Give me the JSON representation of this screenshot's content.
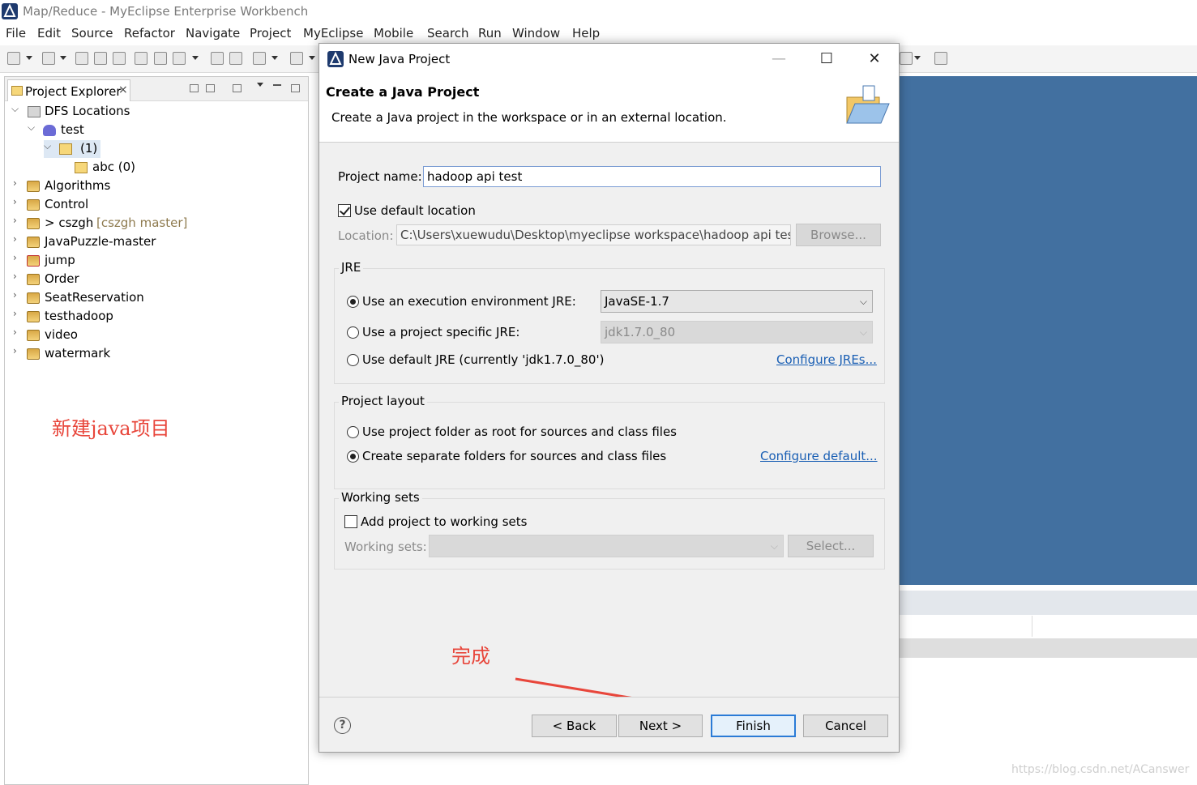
{
  "window": {
    "title": "Map/Reduce - MyEclipse Enterprise Workbench"
  },
  "menu": [
    "File",
    "Edit",
    "Source",
    "Refactor",
    "Navigate",
    "Project",
    "MyEclipse",
    "Mobile",
    "Search",
    "Run",
    "Window",
    "Help"
  ],
  "explorer": {
    "tab_label": "Project Explorer",
    "close_glyph": "×",
    "tree": {
      "dfs": "DFS Locations",
      "test": "test",
      "folder1": "(1)",
      "abc": "abc (0)",
      "projects": [
        {
          "name": "Algorithms"
        },
        {
          "name": "Control"
        },
        {
          "name": "> cszgh",
          "git": "[cszgh master]"
        },
        {
          "name": "JavaPuzzle-master"
        },
        {
          "name": "jump"
        },
        {
          "name": "Order"
        },
        {
          "name": "SeatReservation"
        },
        {
          "name": "testhadoop"
        },
        {
          "name": "video"
        },
        {
          "name": "watermark"
        }
      ]
    }
  },
  "annotations": {
    "new_project": "新建java项目",
    "finish": "完成"
  },
  "watermark": "https://blog.csdn.net/ACanswer",
  "dialog": {
    "title": "New Java Project",
    "heading": "Create a Java Project",
    "description": "Create a Java project in the workspace or in an external location.",
    "project_name_label": "Project name:",
    "project_name_value": "hadoop api test",
    "use_default_location_label": "Use default location",
    "use_default_location_checked": true,
    "location_label": "Location:",
    "location_value": "C:\\Users\\xuewudu\\Desktop\\myeclipse workspace\\hadoop api test",
    "browse_label": "Browse...",
    "jre": {
      "group_label": "JRE",
      "exec_env_label": "Use an execution environment JRE:",
      "exec_env_value": "JavaSE-1.7",
      "project_specific_label": "Use a project specific JRE:",
      "project_specific_value": "jdk1.7.0_80",
      "default_jre_label": "Use default JRE (currently 'jdk1.7.0_80')",
      "configure_link": "Configure JREs...",
      "selected": "exec_env"
    },
    "layout": {
      "group_label": "Project layout",
      "root_label": "Use project folder as root for sources and class files",
      "separate_label": "Create separate folders for sources and class files",
      "configure_link": "Configure default...",
      "selected": "separate"
    },
    "working_sets": {
      "group_label": "Working sets",
      "add_label": "Add project to working sets",
      "add_checked": false,
      "sets_label": "Working sets:",
      "select_label": "Select..."
    },
    "buttons": {
      "back": "< Back",
      "next": "Next >",
      "finish": "Finish",
      "cancel": "Cancel"
    },
    "help_glyph": "?"
  },
  "colors": {
    "accent": "#2b7bd6",
    "annotation": "#e8463b",
    "editor_bg": "#4270a0",
    "link": "#1a5fb4"
  }
}
